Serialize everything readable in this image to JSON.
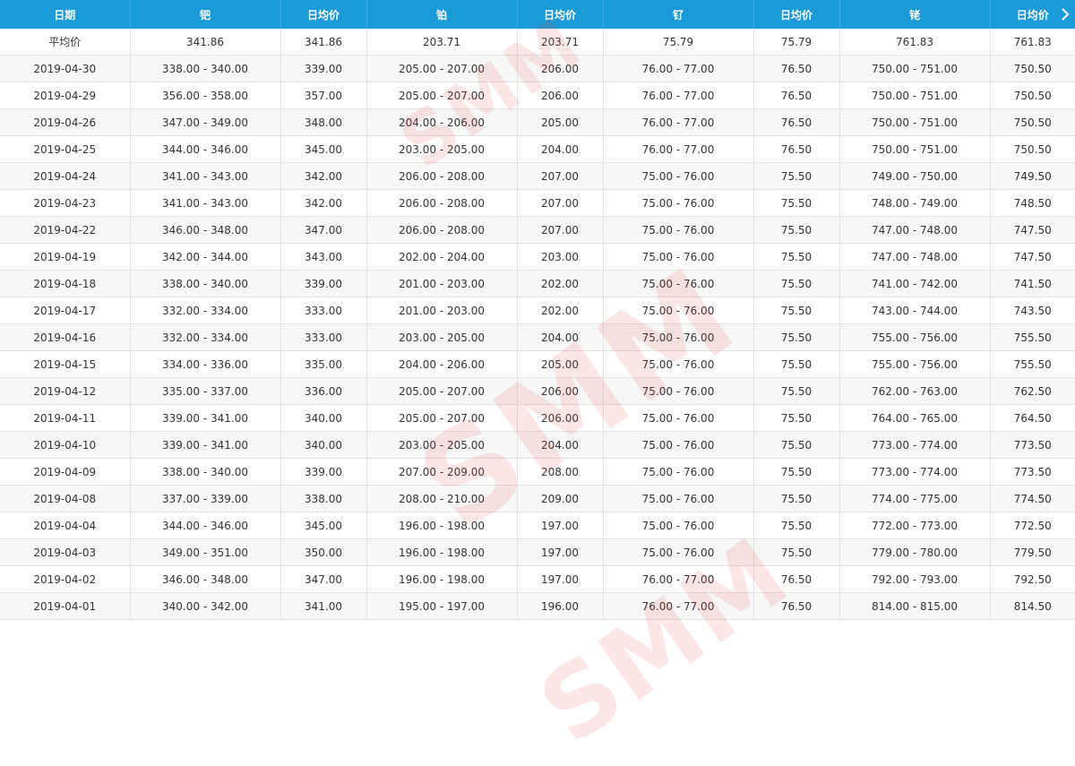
{
  "columns": [
    "日期",
    "钯",
    "日均价",
    "铂",
    "日均价",
    "钌",
    "日均价",
    "铑",
    "日均价"
  ],
  "average_row": [
    "平均价",
    "341.86",
    "341.86",
    "203.71",
    "203.71",
    "75.79",
    "75.79",
    "761.83",
    "761.83"
  ],
  "rows": [
    [
      "2019-04-30",
      "338.00 - 340.00",
      "339.00",
      "205.00 - 207.00",
      "206.00",
      "76.00 - 77.00",
      "76.50",
      "750.00 - 751.00",
      "750.50"
    ],
    [
      "2019-04-29",
      "356.00 - 358.00",
      "357.00",
      "205.00 - 207.00",
      "206.00",
      "76.00 - 77.00",
      "76.50",
      "750.00 - 751.00",
      "750.50"
    ],
    [
      "2019-04-26",
      "347.00 - 349.00",
      "348.00",
      "204.00 - 206.00",
      "205.00",
      "76.00 - 77.00",
      "76.50",
      "750.00 - 751.00",
      "750.50"
    ],
    [
      "2019-04-25",
      "344.00 - 346.00",
      "345.00",
      "203.00 - 205.00",
      "204.00",
      "76.00 - 77.00",
      "76.50",
      "750.00 - 751.00",
      "750.50"
    ],
    [
      "2019-04-24",
      "341.00 - 343.00",
      "342.00",
      "206.00 - 208.00",
      "207.00",
      "75.00 - 76.00",
      "75.50",
      "749.00 - 750.00",
      "749.50"
    ],
    [
      "2019-04-23",
      "341.00 - 343.00",
      "342.00",
      "206.00 - 208.00",
      "207.00",
      "75.00 - 76.00",
      "75.50",
      "748.00 - 749.00",
      "748.50"
    ],
    [
      "2019-04-22",
      "346.00 - 348.00",
      "347.00",
      "206.00 - 208.00",
      "207.00",
      "75.00 - 76.00",
      "75.50",
      "747.00 - 748.00",
      "747.50"
    ],
    [
      "2019-04-19",
      "342.00 - 344.00",
      "343.00",
      "202.00 - 204.00",
      "203.00",
      "75.00 - 76.00",
      "75.50",
      "747.00 - 748.00",
      "747.50"
    ],
    [
      "2019-04-18",
      "338.00 - 340.00",
      "339.00",
      "201.00 - 203.00",
      "202.00",
      "75.00 - 76.00",
      "75.50",
      "741.00 - 742.00",
      "741.50"
    ],
    [
      "2019-04-17",
      "332.00 - 334.00",
      "333.00",
      "201.00 - 203.00",
      "202.00",
      "75.00 - 76.00",
      "75.50",
      "743.00 - 744.00",
      "743.50"
    ],
    [
      "2019-04-16",
      "332.00 - 334.00",
      "333.00",
      "203.00 - 205.00",
      "204.00",
      "75.00 - 76.00",
      "75.50",
      "755.00 - 756.00",
      "755.50"
    ],
    [
      "2019-04-15",
      "334.00 - 336.00",
      "335.00",
      "204.00 - 206.00",
      "205.00",
      "75.00 - 76.00",
      "75.50",
      "755.00 - 756.00",
      "755.50"
    ],
    [
      "2019-04-12",
      "335.00 - 337.00",
      "336.00",
      "205.00 - 207.00",
      "206.00",
      "75.00 - 76.00",
      "75.50",
      "762.00 - 763.00",
      "762.50"
    ],
    [
      "2019-04-11",
      "339.00 - 341.00",
      "340.00",
      "205.00 - 207.00",
      "206.00",
      "75.00 - 76.00",
      "75.50",
      "764.00 - 765.00",
      "764.50"
    ],
    [
      "2019-04-10",
      "339.00 - 341.00",
      "340.00",
      "203.00 - 205.00",
      "204.00",
      "75.00 - 76.00",
      "75.50",
      "773.00 - 774.00",
      "773.50"
    ],
    [
      "2019-04-09",
      "338.00 - 340.00",
      "339.00",
      "207.00 - 209.00",
      "208.00",
      "75.00 - 76.00",
      "75.50",
      "773.00 - 774.00",
      "773.50"
    ],
    [
      "2019-04-08",
      "337.00 - 339.00",
      "338.00",
      "208.00 - 210.00",
      "209.00",
      "75.00 - 76.00",
      "75.50",
      "774.00 - 775.00",
      "774.50"
    ],
    [
      "2019-04-04",
      "344.00 - 346.00",
      "345.00",
      "196.00 - 198.00",
      "197.00",
      "75.00 - 76.00",
      "75.50",
      "772.00 - 773.00",
      "772.50"
    ],
    [
      "2019-04-03",
      "349.00 - 351.00",
      "350.00",
      "196.00 - 198.00",
      "197.00",
      "75.00 - 76.00",
      "75.50",
      "779.00 - 780.00",
      "779.50"
    ],
    [
      "2019-04-02",
      "346.00 - 348.00",
      "347.00",
      "196.00 - 198.00",
      "197.00",
      "76.00 - 77.00",
      "76.50",
      "792.00 - 793.00",
      "792.50"
    ],
    [
      "2019-04-01",
      "340.00 - 342.00",
      "341.00",
      "195.00 - 197.00",
      "196.00",
      "76.00 - 77.00",
      "76.50",
      "814.00 - 815.00",
      "814.50"
    ]
  ],
  "watermark": "SMM",
  "header_next_icon": "chevron-right-icon",
  "colors": {
    "header_bg": "#1a9ad6",
    "header_text": "#ffffff",
    "row_alt": "#f7f7f7",
    "watermark": "#eb3c3c"
  }
}
